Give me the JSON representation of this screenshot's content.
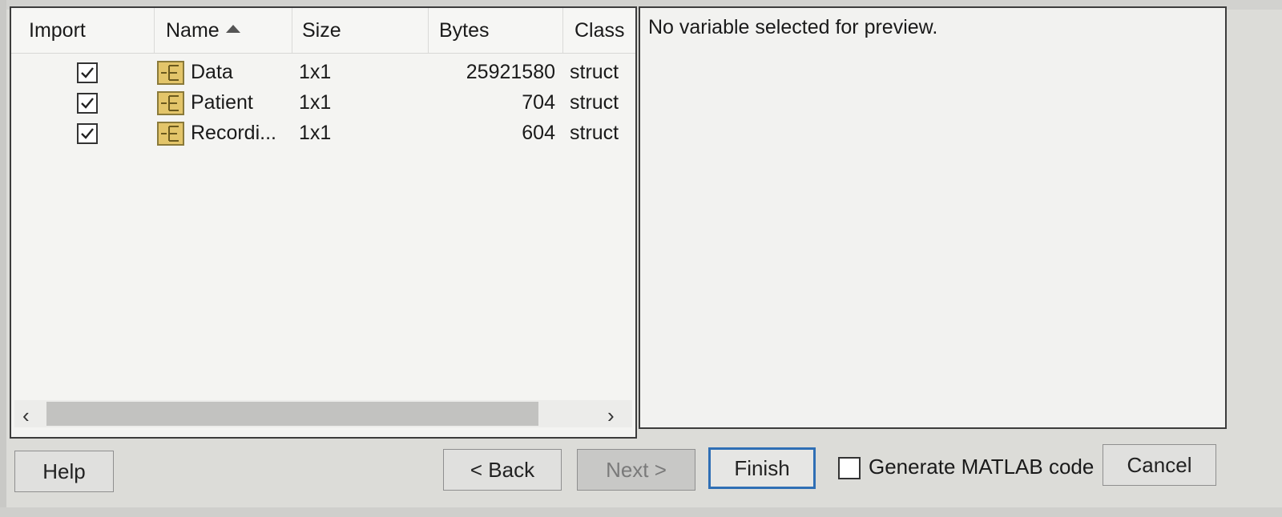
{
  "columns": {
    "import": "Import",
    "name": "Name",
    "size": "Size",
    "bytes": "Bytes",
    "class": "Class"
  },
  "variables": [
    {
      "checked": true,
      "name": "Data",
      "size": "1x1",
      "bytes": "25921580",
      "class": "struct"
    },
    {
      "checked": true,
      "name": "Patient",
      "size": "1x1",
      "bytes": "704",
      "class": "struct"
    },
    {
      "checked": true,
      "name": "Recordi...",
      "size": "1x1",
      "bytes": "604",
      "class": "struct"
    }
  ],
  "preview": {
    "message": "No variable selected for preview."
  },
  "buttons": {
    "help": "Help",
    "back": "< Back",
    "next": "Next >",
    "finish": "Finish",
    "cancel": "Cancel"
  },
  "generate_code": {
    "label": "Generate MATLAB code",
    "checked": false
  },
  "icons": {
    "variable": "struct-icon",
    "sort": "sort-ascending-icon"
  },
  "colors": {
    "accent": "#2f6fb5",
    "struct_icon": "#e3c56a"
  }
}
